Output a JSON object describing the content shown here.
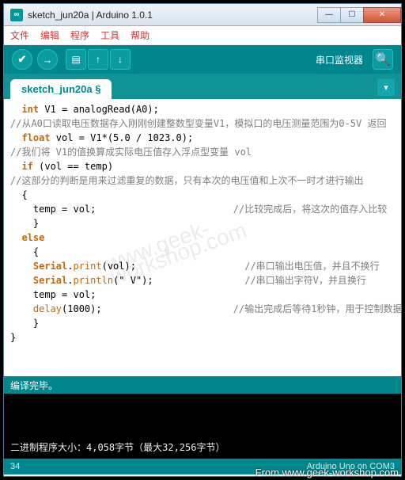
{
  "window": {
    "title": "sketch_jun20a | Arduino 1.0.1",
    "app_icon_text": "∞"
  },
  "menu": [
    "文件",
    "编辑",
    "程序",
    "工具",
    "帮助"
  ],
  "toolbar": {
    "verify_icon": "✔",
    "upload_icon": "→",
    "new_icon": "▤",
    "open_icon": "↑",
    "save_icon": "↓",
    "serial_label": "串口监视器",
    "serial_icon": "🔍"
  },
  "tab": {
    "name": "sketch_jun20a §",
    "menu_icon": "▾"
  },
  "code": {
    "l1_a": "  int",
    "l1_b": " V1 = analogRead(A0);",
    "l2": "//从A0口读取电压数据存入刚刚创建整数型变量V1，模拟口的电压测量范围为0-5V 返回",
    "l3_a": "  float",
    "l3_b": " vol = V1*(5.0 / 1023.0);",
    "l4": "//我们将 V1的值换算成实际电压值存入浮点型变量 vol",
    "l5_a": "  if",
    "l5_b": " (vol == temp)",
    "l6": "//这部分的判断是用来过滤重复的数据，只有本次的电压值和上次不一时才进行输出",
    "l7": "  {",
    "l8_a": "    temp = vol;                        ",
    "l8_b": "//比较完成后，将这次的值存入比较",
    "l9": "    }",
    "l10_a": "  else",
    "l11": "    {",
    "l12_a": "    Serial",
    "l12_b": ".",
    "l12_c": "print",
    "l12_d": "(vol);                   ",
    "l12_e": "//串口输出电压值，并且不换行",
    "l13_a": "    Serial",
    "l13_b": ".",
    "l13_c": "println",
    "l13_d": "(\" V\");                ",
    "l13_e": "//串口输出字符V，并且换行",
    "l14": "    temp = vol;",
    "l15_a": "    delay",
    "l15_b": "(1000);                       ",
    "l15_c": "//输出完成后等待1秒钟，用于控制数据",
    "l16": "    }",
    "l17": "}"
  },
  "status": {
    "compile_done": "编译完毕。"
  },
  "console": {
    "size_line": "二进制程序大小：4,058字节（最大32,256字节）"
  },
  "footer": {
    "line": "34",
    "board": "Arduino Uno on COM3"
  },
  "watermark": "www.geek-workshop.com",
  "credit": "From www.geek-workshop.com"
}
